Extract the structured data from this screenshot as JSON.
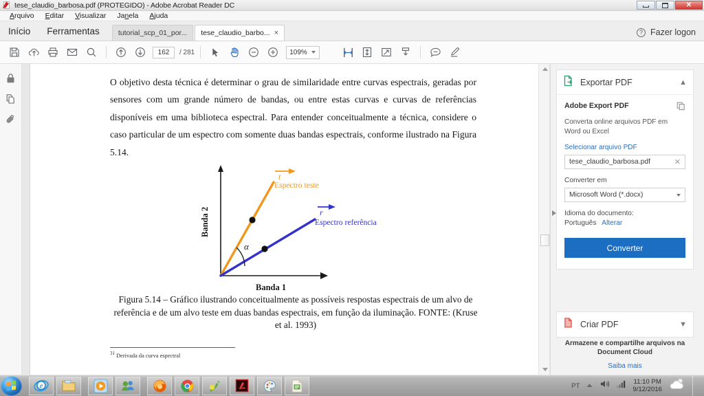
{
  "window": {
    "title": "tese_claudio_barbosa.pdf (PROTEGIDO) - Adobe Acrobat Reader DC",
    "app_icon": "acrobat-icon",
    "controls": {
      "minimize": "minimize-button",
      "maximize": "maximize-button",
      "close": "close-button"
    }
  },
  "menubar": {
    "items": [
      {
        "label": "Arquivo",
        "accel": "A"
      },
      {
        "label": "Editar",
        "accel": "E"
      },
      {
        "label": "Visualizar",
        "accel": "V"
      },
      {
        "label": "Janela",
        "accel": "n"
      },
      {
        "label": "Ajuda",
        "accel": "A"
      }
    ]
  },
  "tabbar": {
    "home": "Início",
    "tools": "Ferramentas",
    "docs": [
      {
        "label": "tutorial_scp_01_por...",
        "active": false,
        "closable": false
      },
      {
        "label": "tese_claudio_barbo...",
        "active": true,
        "closable": true,
        "close": "×"
      }
    ],
    "help_icon": "?",
    "logon": "Fazer logon"
  },
  "toolbar": {
    "save": "save-icon",
    "upload": "upload-cloud-icon",
    "print": "print-icon",
    "email": "email-icon",
    "search": "search-icon",
    "prev_page": "previous-page-icon",
    "next_page": "next-page-icon",
    "page_current": "162",
    "page_total": "/ 281",
    "select_tool": "cursor-icon",
    "hand_tool": "hand-icon",
    "zoom_out": "zoom-out-icon",
    "zoom_in": "zoom-in-icon",
    "zoom_level": "109%",
    "fit_width": "fit-width-icon",
    "fit_page": "fit-page-icon",
    "fullscreen": "fullscreen-icon",
    "scroll_mode": "scroll-mode-icon",
    "comment": "comment-icon",
    "highlight": "highlight-pen-icon",
    "accent_color": "#2f6fb5"
  },
  "leftrail": {
    "items": [
      {
        "name": "security-lock-icon"
      },
      {
        "name": "page-thumbnails-icon"
      },
      {
        "name": "attachments-icon"
      }
    ],
    "expand": "expand-navigation-pane"
  },
  "document": {
    "paragraph": "O objetivo desta técnica é determinar o grau de similaridade entre curvas espectrais, geradas por sensores com um grande número de bandas, ou entre estas curvas e curvas de referências disponíveis em uma biblioteca espectral. Para entender conceitualmente a técnica, considere o caso particular de um espectro com somente duas bandas espectrais, conforme ilustrado na Figura 5.14.",
    "caption": "Figura 5.14 – Gráfico ilustrando conceitualmente as possíveis respostas espectrais de um alvo de referência e de um alvo teste em duas bandas espectrais, em função da iluminação. FONTE: (Kruse et al. 1993)",
    "footnote_marker": "31",
    "footnote_text": "Derivada da curva espectral"
  },
  "chart_data": {
    "type": "line",
    "title": "Figura 5.14",
    "xlabel": "Banda 1",
    "ylabel": "Banda 2",
    "grid": false,
    "legend": "inline-labels",
    "annotations": [
      {
        "text": "α",
        "role": "angle-between-vectors"
      },
      {
        "text": "t",
        "role": "test-vector-symbol",
        "color": "#F0971E"
      },
      {
        "text": "r",
        "role": "reference-vector-symbol",
        "color": "#3333CC"
      }
    ],
    "series": [
      {
        "name": "Espectro teste",
        "color": "#F0971E",
        "x": [
          0,
          0.56
        ],
        "y": [
          0,
          1.0
        ],
        "point": {
          "x": 0.33,
          "y": 0.59
        }
      },
      {
        "name": "Espectro referência",
        "color": "#3333CC",
        "x": [
          0,
          1.0
        ],
        "y": [
          0,
          0.6
        ],
        "point": {
          "x": 0.44,
          "y": 0.26
        }
      }
    ]
  },
  "right_panel": {
    "export_card": {
      "icon": "export-pdf-icon",
      "title": "Exportar PDF",
      "collapse_icon": "chevron-up-icon",
      "heading": "Adobe Export PDF",
      "copy_icon": "copy-icon",
      "description": "Converta online arquivos PDF em Word ou Excel",
      "select_file_link": "Selecionar arquivo PDF",
      "file_value": "tese_claudio_barbosa.pdf",
      "file_clear": "✕",
      "convert_to_label": "Converter em",
      "convert_to_value": "Microsoft Word (*.docx)",
      "language_label": "Idioma do documento:",
      "language_value": "Português",
      "language_change": "Alterar",
      "convert_button": "Converter",
      "button_color": "#1b6ec2"
    },
    "create_card": {
      "icon": "create-pdf-icon",
      "title": "Criar PDF",
      "expand_icon": "chevron-down-icon"
    },
    "footer": {
      "line1": "Armazene e compartilhe arquivos na",
      "line2": "Document Cloud",
      "learn_more": "Saiba mais"
    },
    "collapse_handle": "collapse-right-panel"
  },
  "taskbar": {
    "start": "windows-start-orb",
    "items": [
      {
        "name": "internet-explorer-icon"
      },
      {
        "name": "windows-explorer-icon"
      },
      {
        "name": "windows-media-player-icon"
      },
      {
        "name": "messenger-icon"
      },
      {
        "name": "firefox-icon"
      },
      {
        "name": "chrome-icon"
      },
      {
        "name": "green-app-icon"
      },
      {
        "name": "adobe-acrobat-icon"
      },
      {
        "name": "paint-icon"
      },
      {
        "name": "libreoffice-icon"
      }
    ],
    "tray": {
      "language": "PT",
      "chevron": "show-hidden-icons",
      "volume": "volume-icon",
      "network": "network-icon",
      "time": "11:10 PM",
      "date": "9/12/2016",
      "weather": "weather-icon"
    }
  }
}
